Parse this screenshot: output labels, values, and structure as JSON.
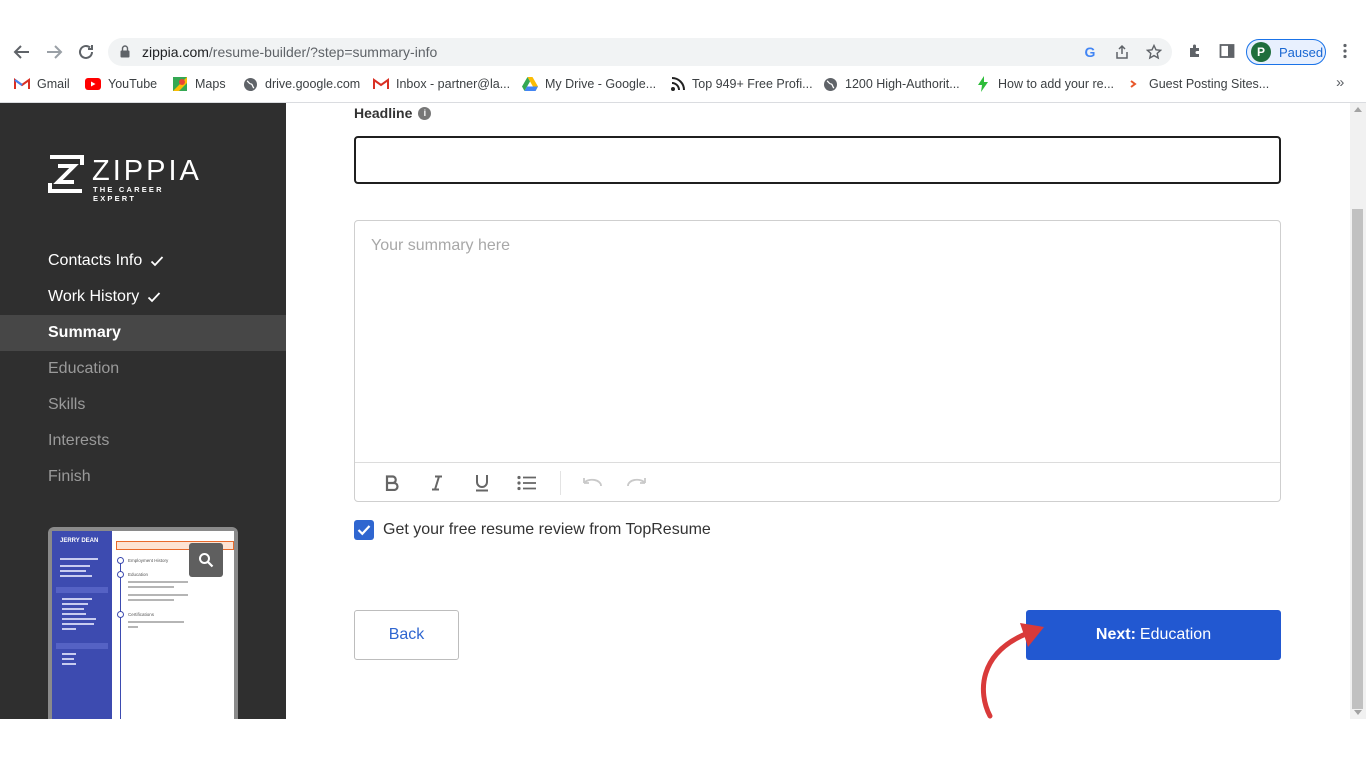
{
  "browser": {
    "url_host": "zippia.com",
    "url_path": "/resume-builder/?step=summary-info",
    "profile_initial": "P",
    "profile_status": "Paused",
    "bookmarks": [
      {
        "label": "Gmail",
        "icon": "gmail-icon"
      },
      {
        "label": "YouTube",
        "icon": "youtube-icon"
      },
      {
        "label": "Maps",
        "icon": "maps-icon"
      },
      {
        "label": "drive.google.com",
        "icon": "globe-icon"
      },
      {
        "label": "Inbox - partner@la...",
        "icon": "gmail-icon"
      },
      {
        "label": "My Drive - Google...",
        "icon": "google-drive-icon"
      },
      {
        "label": "Top 949+ Free Profi...",
        "icon": "rss-icon"
      },
      {
        "label": "1200 High-Authorit...",
        "icon": "globe-icon"
      },
      {
        "label": "How to add your re...",
        "icon": "bolt-icon"
      },
      {
        "label": "Guest Posting Sites...",
        "icon": "arrow-icon"
      }
    ]
  },
  "sidebar": {
    "logo_word": "ZIPPIA",
    "logo_tagline": "THE CAREER EXPERT",
    "steps": [
      {
        "label": "Contacts Info",
        "state": "done"
      },
      {
        "label": "Work History",
        "state": "done"
      },
      {
        "label": "Summary",
        "state": "active"
      },
      {
        "label": "Education",
        "state": "pending"
      },
      {
        "label": "Skills",
        "state": "pending"
      },
      {
        "label": "Interests",
        "state": "pending"
      },
      {
        "label": "Finish",
        "state": "pending"
      }
    ],
    "preview": {
      "name": "JERRY DEAN",
      "sections": [
        "Employment History",
        "Education",
        "Certifications"
      ]
    }
  },
  "form": {
    "headline_label": "Headline",
    "headline_value": "",
    "summary_placeholder": "Your summary here",
    "review_checkbox_label": "Get your free resume review from TopResume",
    "review_checked": true,
    "back_label": "Back",
    "next_prefix": "Next:",
    "next_label": "Education"
  },
  "colors": {
    "sidebar_bg": "#2f2f2f",
    "sidebar_active": "#474747",
    "primary": "#2258d1",
    "annotation_arrow": "#d93a3a"
  }
}
